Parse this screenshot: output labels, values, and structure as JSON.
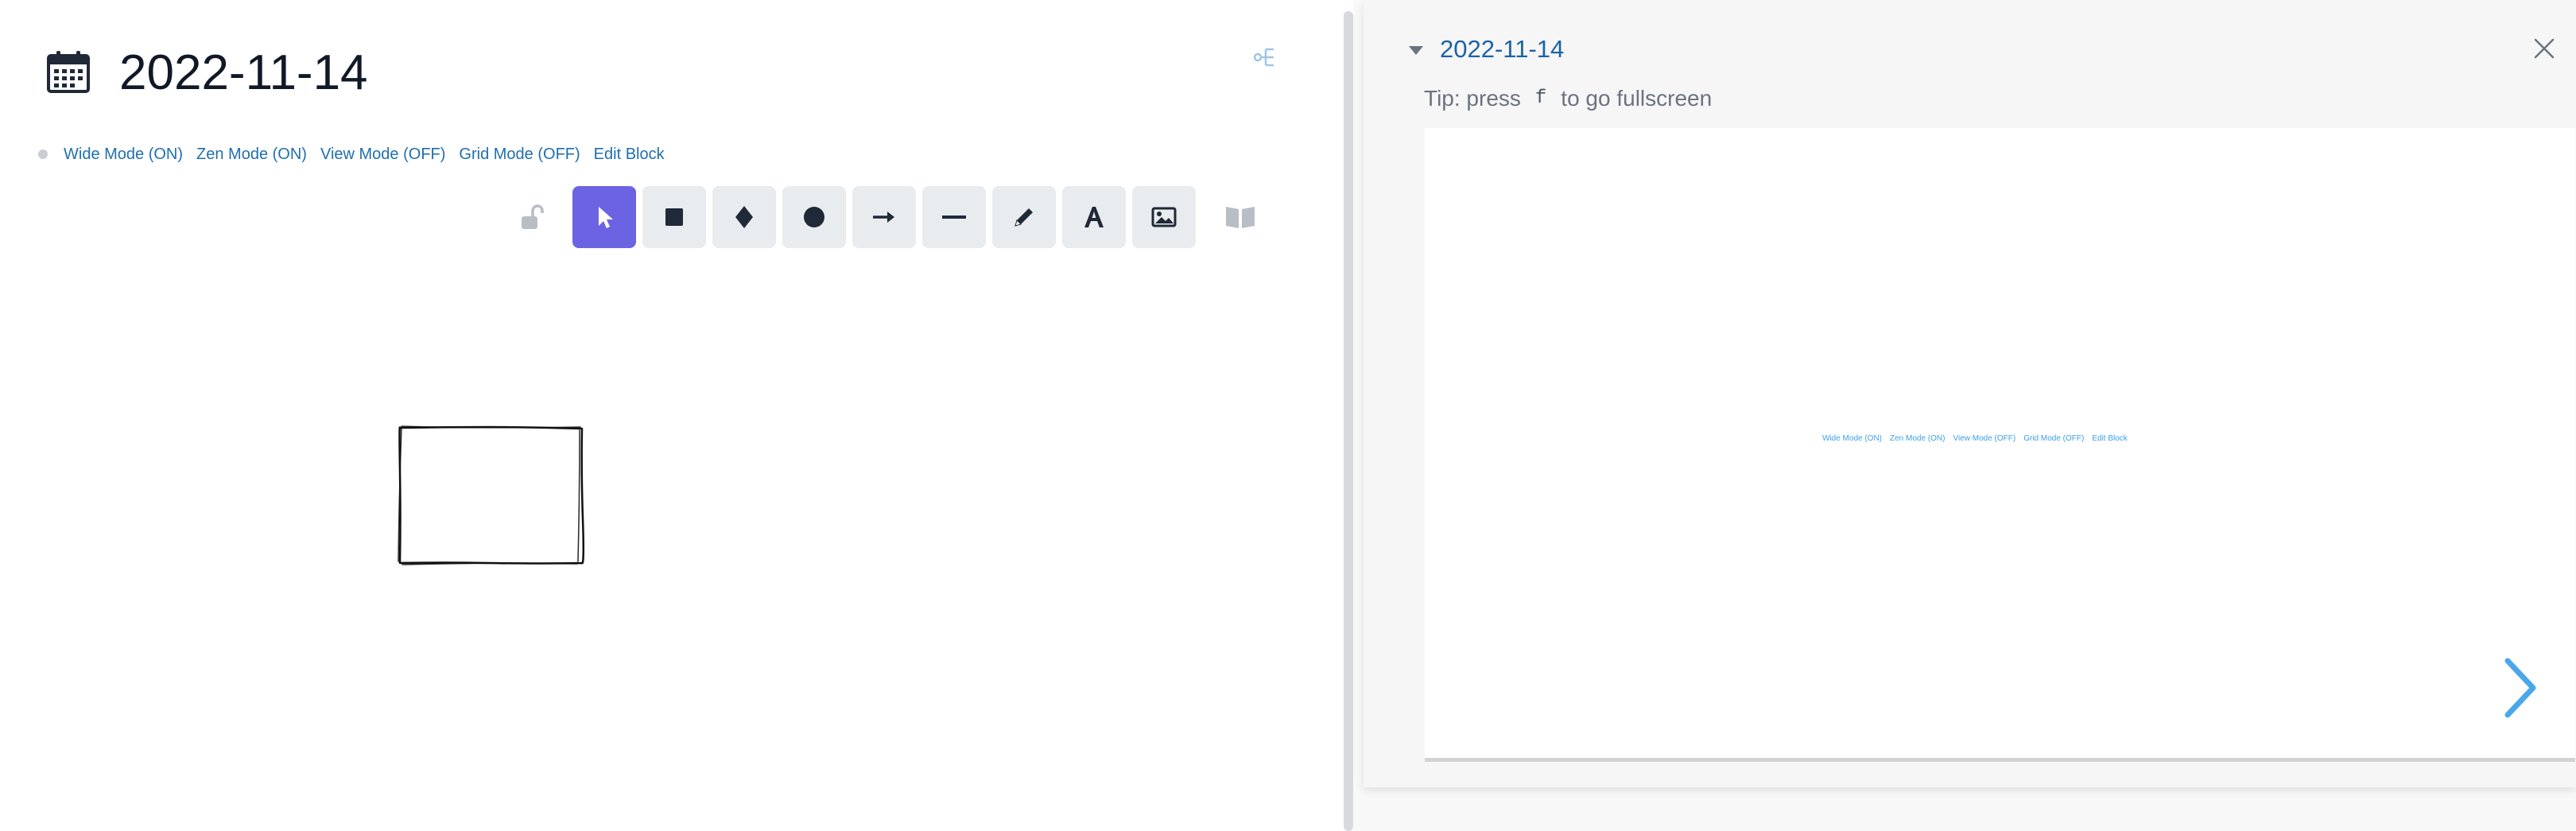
{
  "page": {
    "title": "2022-11-14",
    "icon": "calendar-icon"
  },
  "modes": [
    {
      "label": "Wide Mode (ON)"
    },
    {
      "label": "Zen Mode (ON)"
    },
    {
      "label": "View Mode (OFF)"
    },
    {
      "label": "Grid Mode (OFF)"
    },
    {
      "label": "Edit Block"
    }
  ],
  "toolbar": {
    "lock_icon": "unlock-icon",
    "tools": [
      {
        "name": "selection",
        "icon": "pointer-icon",
        "active": true
      },
      {
        "name": "rectangle",
        "icon": "square-icon",
        "active": false
      },
      {
        "name": "diamond",
        "icon": "diamond-icon",
        "active": false
      },
      {
        "name": "ellipse",
        "icon": "circle-icon",
        "active": false
      },
      {
        "name": "arrow",
        "icon": "arrow-right-icon",
        "active": false
      },
      {
        "name": "line",
        "icon": "line-icon",
        "active": false
      },
      {
        "name": "draw",
        "icon": "pencil-icon",
        "active": false
      },
      {
        "name": "text",
        "icon": "text-icon",
        "active": false
      },
      {
        "name": "image",
        "icon": "image-icon",
        "active": false
      }
    ],
    "library_icon": "book-open-icon",
    "active_color": "#6c63e3"
  },
  "sidebar": {
    "title": "2022-11-14",
    "tip_prefix": "Tip: press",
    "tip_key": "f",
    "tip_suffix": "to go fullscreen",
    "preview_modes": [
      {
        "label": "Wide Mode (ON)"
      },
      {
        "label": "Zen Mode (ON)"
      },
      {
        "label": "View Mode (OFF)"
      },
      {
        "label": "Grid Mode (OFF)"
      },
      {
        "label": "Edit Block"
      }
    ],
    "link_color": "#1b63a8",
    "next_arrow_color": "#4aa8ea"
  }
}
